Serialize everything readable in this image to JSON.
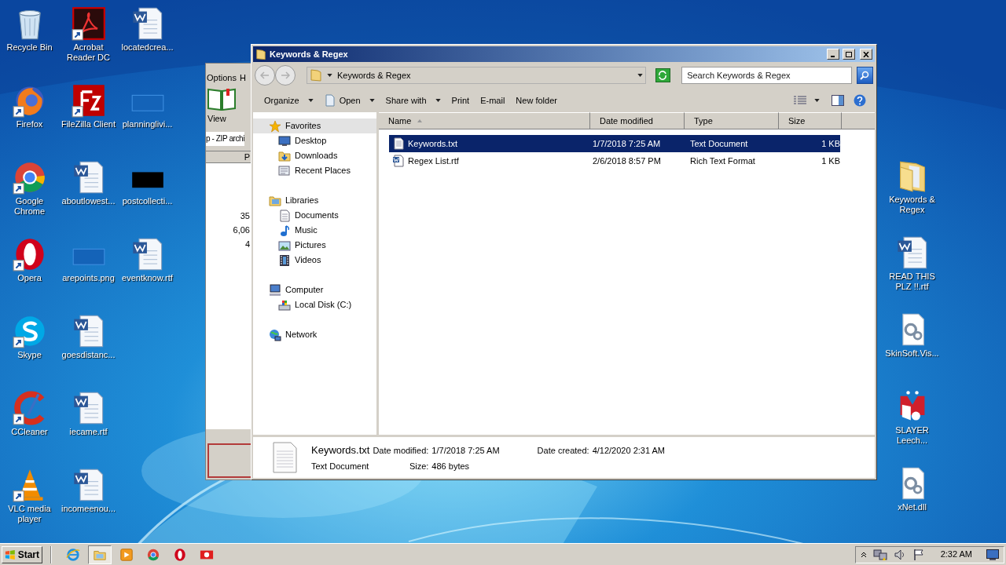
{
  "desktop": {
    "left_icons": [
      [
        {
          "label": "Recycle Bin",
          "kind": "recycle",
          "shortcut": false
        },
        {
          "label": "Acrobat Reader DC",
          "kind": "acrobat",
          "shortcut": true
        },
        {
          "label": "locatedcrea...",
          "kind": "word",
          "shortcut": false
        }
      ],
      [
        {
          "label": "Firefox",
          "kind": "firefox",
          "shortcut": true
        },
        {
          "label": "FileZilla Client",
          "kind": "filezilla",
          "shortcut": true
        },
        {
          "label": "planninglivi...",
          "kind": "blank",
          "shortcut": false
        }
      ],
      [
        {
          "label": "Google Chrome",
          "kind": "chrome",
          "shortcut": true
        },
        {
          "label": "aboutlowest...",
          "kind": "word",
          "shortcut": false
        },
        {
          "label": "postcollecti...",
          "kind": "black",
          "shortcut": false
        }
      ],
      [
        {
          "label": "Opera",
          "kind": "opera",
          "shortcut": true
        },
        {
          "label": "arepoints.png",
          "kind": "blank",
          "shortcut": false
        },
        {
          "label": "eventknow.rtf",
          "kind": "word",
          "shortcut": false
        }
      ],
      [
        {
          "label": "Skype",
          "kind": "skype",
          "shortcut": true
        },
        {
          "label": "goesdistanc...",
          "kind": "word",
          "shortcut": false
        }
      ],
      [
        {
          "label": "CCleaner",
          "kind": "ccleaner",
          "shortcut": true
        },
        {
          "label": "iecame.rtf",
          "kind": "word",
          "shortcut": false
        }
      ],
      [
        {
          "label": "VLC media player",
          "kind": "vlc",
          "shortcut": true
        },
        {
          "label": "incomeenou...",
          "kind": "word",
          "shortcut": false
        }
      ]
    ],
    "right_icons": [
      {
        "label": "Keywords & Regex",
        "kind": "folder",
        "shortcut": false
      },
      {
        "label": "READ THIS PLZ !!.rtf",
        "kind": "word",
        "shortcut": false
      },
      {
        "label": "SkinSoft.Vis...",
        "kind": "gear",
        "shortcut": false
      },
      {
        "label": "SLAYER Leech...",
        "kind": "slayer",
        "shortcut": false
      },
      {
        "label": "xNet.dll",
        "kind": "gear",
        "shortcut": false
      }
    ]
  },
  "background_window": {
    "menu": [
      "Options",
      "H"
    ],
    "toolbar_button": "View",
    "address": "p - ZIP archi",
    "column_1": "P",
    "cells": [
      "35",
      "6,06",
      "4"
    ]
  },
  "explorer": {
    "title": "Keywords & Regex",
    "address": "Keywords & Regex",
    "search": {
      "placeholder": "Search Keywords & Regex"
    },
    "toolbar": [
      {
        "label": "Organize",
        "dropdown": true,
        "kind": "plain"
      },
      {
        "label": "Open",
        "dropdown": true,
        "kind": "open"
      },
      {
        "label": "Share with",
        "dropdown": true,
        "kind": "plain"
      },
      {
        "label": "Print",
        "dropdown": false,
        "kind": "plain"
      },
      {
        "label": "E-mail",
        "dropdown": false,
        "kind": "plain"
      },
      {
        "label": "New folder",
        "dropdown": false,
        "kind": "plain"
      }
    ],
    "nav": [
      {
        "label": "Favorites",
        "kind": "star",
        "selected": true,
        "children": [
          {
            "label": "Desktop",
            "kind": "desktop",
            "selected": false
          },
          {
            "label": "Downloads",
            "kind": "downloads",
            "selected": false
          },
          {
            "label": "Recent Places",
            "kind": "recent",
            "selected": false
          }
        ]
      },
      {
        "label": "Libraries",
        "kind": "libraries",
        "selected": false,
        "children": [
          {
            "label": "Documents",
            "kind": "documents",
            "selected": false
          },
          {
            "label": "Music",
            "kind": "music",
            "selected": false
          },
          {
            "label": "Pictures",
            "kind": "pictures",
            "selected": false
          },
          {
            "label": "Videos",
            "kind": "videos",
            "selected": false
          }
        ]
      },
      {
        "label": "Computer",
        "kind": "computer",
        "selected": false,
        "children": [
          {
            "label": "Local Disk (C:)",
            "kind": "disk",
            "selected": false
          }
        ]
      },
      {
        "label": "Network",
        "kind": "network",
        "selected": false
      }
    ],
    "columns": [
      {
        "label": "Name",
        "sorted": true
      },
      {
        "label": "Date modified",
        "sorted": false
      },
      {
        "label": "Type",
        "sorted": false
      },
      {
        "label": "Size",
        "sorted": false
      }
    ],
    "files": [
      {
        "name": "Keywords.txt",
        "date": "1/7/2018 7:25 AM",
        "type": "Text Document",
        "size": "1 KB",
        "kind": "text",
        "selected": true
      },
      {
        "name": "Regex List.rtf",
        "date": "2/6/2018 8:57 PM",
        "type": "Rich Text Format",
        "size": "1 KB",
        "kind": "word",
        "selected": false
      }
    ],
    "details": {
      "name": "Keywords.txt",
      "type": "Text Document",
      "fields": [
        {
          "label": "Date modified:",
          "value": "1/7/2018 7:25 AM"
        },
        {
          "label": "Size:",
          "value": "486 bytes"
        },
        {
          "label": "Date created:",
          "value": "4/12/2020 2:31 AM"
        }
      ]
    }
  },
  "taskbar": {
    "start": "Start",
    "apps": [
      {
        "kind": "ie",
        "selected": false
      },
      {
        "kind": "explorer",
        "selected": true
      },
      {
        "kind": "media",
        "selected": false
      },
      {
        "kind": "chrome",
        "selected": false
      },
      {
        "kind": "opera",
        "selected": false
      },
      {
        "kind": "flag",
        "selected": false
      }
    ],
    "clock": "2:32 AM"
  }
}
